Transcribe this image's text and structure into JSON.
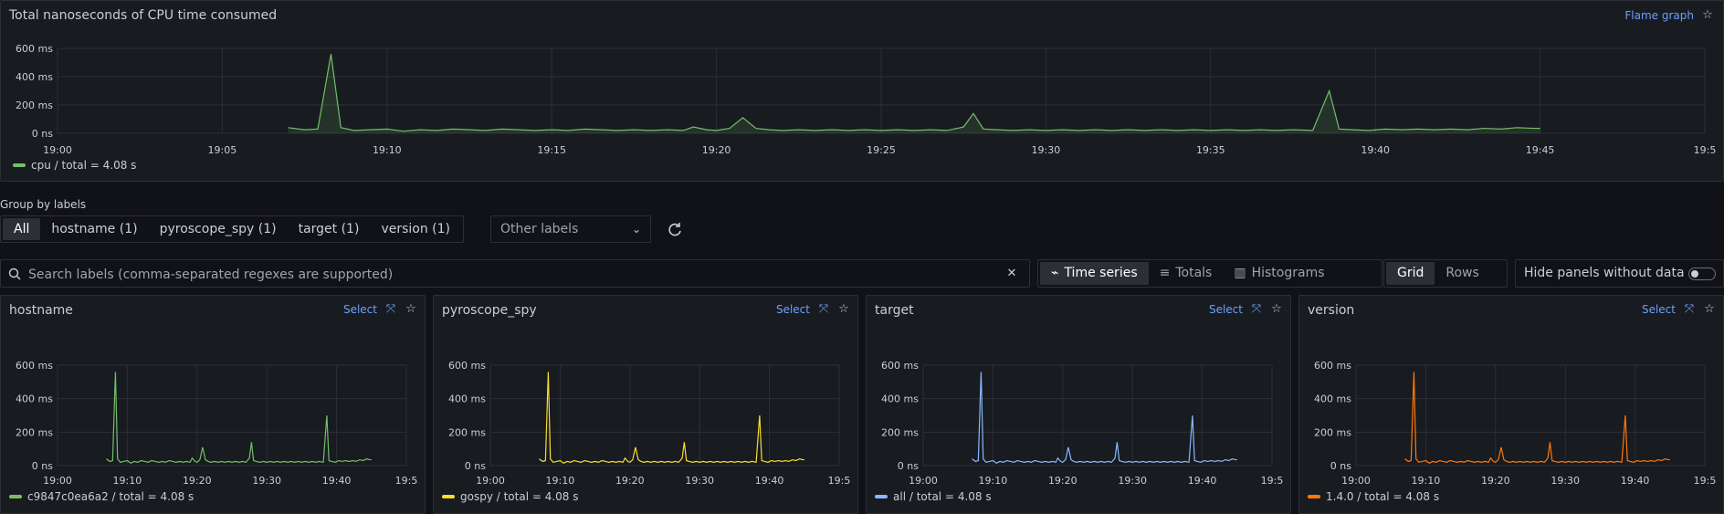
{
  "main_panel": {
    "title": "Total nanoseconds of CPU time consumed",
    "flame_link": "Flame graph",
    "legend": "cpu / total = 4.08 s",
    "color": "#73bf69"
  },
  "group_by": {
    "label": "Group by labels",
    "options": [
      "All",
      "hostname (1)",
      "pyroscope_spy (1)",
      "target (1)",
      "version (1)"
    ],
    "selected": "All",
    "other_labels": "Other labels"
  },
  "search": {
    "placeholder": "Search labels (comma-separated regexes are supported)"
  },
  "view_modes": [
    "Time series",
    "Totals",
    "Histograms"
  ],
  "layout_modes": [
    "Grid",
    "Rows"
  ],
  "hide_panels_label": "Hide panels without data",
  "small_panels": [
    {
      "title": "hostname",
      "select": "Select",
      "legend": "c9847c0ea6a2 / total = 4.08 s",
      "color": "#73bf69"
    },
    {
      "title": "pyroscope_spy",
      "select": "Select",
      "legend": "gospy / total = 4.08 s",
      "color": "#fade2a"
    },
    {
      "title": "target",
      "select": "Select",
      "legend": "all / total = 4.08 s",
      "color": "#8ab8ff"
    },
    {
      "title": "version",
      "select": "Select",
      "legend": "1.4.0 / total = 4.08 s",
      "color": "#ff780a"
    }
  ],
  "chart_data": [
    {
      "type": "area",
      "title": "Total nanoseconds of CPU time consumed",
      "x_ticks": [
        "19:00",
        "19:05",
        "19:10",
        "19:15",
        "19:20",
        "19:25",
        "19:30",
        "19:35",
        "19:40",
        "19:45",
        "19:5"
      ],
      "y_ticks": [
        "0 ns",
        "200 ms",
        "400 ms",
        "600 ms"
      ],
      "ylim": [
        0,
        600
      ],
      "series": [
        {
          "name": "cpu",
          "points": [
            [
              7,
              40
            ],
            [
              7.5,
              25
            ],
            [
              7.9,
              30
            ],
            [
              8.3,
              560
            ],
            [
              8.6,
              40
            ],
            [
              9,
              20
            ],
            [
              9.5,
              25
            ],
            [
              10,
              30
            ],
            [
              10.5,
              15
            ],
            [
              11,
              25
            ],
            [
              11.5,
              20
            ],
            [
              12,
              30
            ],
            [
              12.5,
              25
            ],
            [
              13,
              20
            ],
            [
              13.5,
              30
            ],
            [
              14,
              25
            ],
            [
              14.5,
              20
            ],
            [
              15,
              25
            ],
            [
              15.5,
              20
            ],
            [
              16,
              30
            ],
            [
              16.5,
              25
            ],
            [
              17,
              20
            ],
            [
              17.5,
              25
            ],
            [
              18,
              20
            ],
            [
              18.5,
              25
            ],
            [
              19,
              20
            ],
            [
              19.3,
              45
            ],
            [
              19.7,
              25
            ],
            [
              20,
              20
            ],
            [
              20.4,
              35
            ],
            [
              20.8,
              110
            ],
            [
              21.2,
              35
            ],
            [
              21.6,
              25
            ],
            [
              22,
              20
            ],
            [
              22.5,
              25
            ],
            [
              23,
              20
            ],
            [
              23.5,
              25
            ],
            [
              24,
              20
            ],
            [
              24.5,
              25
            ],
            [
              25,
              20
            ],
            [
              25.5,
              25
            ],
            [
              26,
              20
            ],
            [
              26.5,
              25
            ],
            [
              27,
              20
            ],
            [
              27.5,
              45
            ],
            [
              27.8,
              140
            ],
            [
              28.1,
              30
            ],
            [
              28.5,
              25
            ],
            [
              29,
              20
            ],
            [
              29.5,
              25
            ],
            [
              30,
              20
            ],
            [
              30.5,
              25
            ],
            [
              31,
              20
            ],
            [
              31.5,
              25
            ],
            [
              32,
              20
            ],
            [
              32.5,
              25
            ],
            [
              33,
              20
            ],
            [
              33.5,
              25
            ],
            [
              34,
              20
            ],
            [
              34.5,
              25
            ],
            [
              35,
              20
            ],
            [
              35.5,
              25
            ],
            [
              36,
              20
            ],
            [
              36.5,
              25
            ],
            [
              37,
              20
            ],
            [
              37.5,
              25
            ],
            [
              38.1,
              20
            ],
            [
              38.6,
              300
            ],
            [
              38.9,
              30
            ],
            [
              39.3,
              25
            ],
            [
              39.8,
              20
            ],
            [
              40.3,
              30
            ],
            [
              40.8,
              25
            ],
            [
              41.3,
              30
            ],
            [
              41.8,
              25
            ],
            [
              42.3,
              30
            ],
            [
              42.8,
              25
            ],
            [
              43.3,
              35
            ],
            [
              43.8,
              30
            ],
            [
              44.3,
              40
            ],
            [
              44.8,
              35
            ],
            [
              45,
              35
            ]
          ]
        }
      ]
    },
    {
      "type": "line",
      "title": "hostname",
      "x_ticks": [
        "19:00",
        "19:10",
        "19:20",
        "19:30",
        "19:40",
        "19:5"
      ],
      "y_ticks": [
        "0 ns",
        "200 ms",
        "400 ms",
        "600 ms"
      ],
      "ylim": [
        0,
        600
      ],
      "series": [
        {
          "name": "c9847c0ea6a2",
          "ref": 0
        }
      ]
    },
    {
      "type": "line",
      "title": "pyroscope_spy",
      "x_ticks": [
        "19:00",
        "19:10",
        "19:20",
        "19:30",
        "19:40",
        "19:5"
      ],
      "y_ticks": [
        "0 ns",
        "200 ms",
        "400 ms",
        "600 ms"
      ],
      "ylim": [
        0,
        600
      ],
      "series": [
        {
          "name": "gospy",
          "ref": 0
        }
      ]
    },
    {
      "type": "line",
      "title": "target",
      "x_ticks": [
        "19:00",
        "19:10",
        "19:20",
        "19:30",
        "19:40",
        "19:5"
      ],
      "y_ticks": [
        "0 ns",
        "200 ms",
        "400 ms",
        "600 ms"
      ],
      "ylim": [
        0,
        600
      ],
      "series": [
        {
          "name": "all",
          "ref": 0
        }
      ]
    },
    {
      "type": "line",
      "title": "version",
      "x_ticks": [
        "19:00",
        "19:10",
        "19:20",
        "19:30",
        "19:40",
        "19:5"
      ],
      "y_ticks": [
        "0 ns",
        "200 ms",
        "400 ms",
        "600 ms"
      ],
      "ylim": [
        0,
        600
      ],
      "series": [
        {
          "name": "1.4.0",
          "ref": 0
        }
      ]
    }
  ]
}
